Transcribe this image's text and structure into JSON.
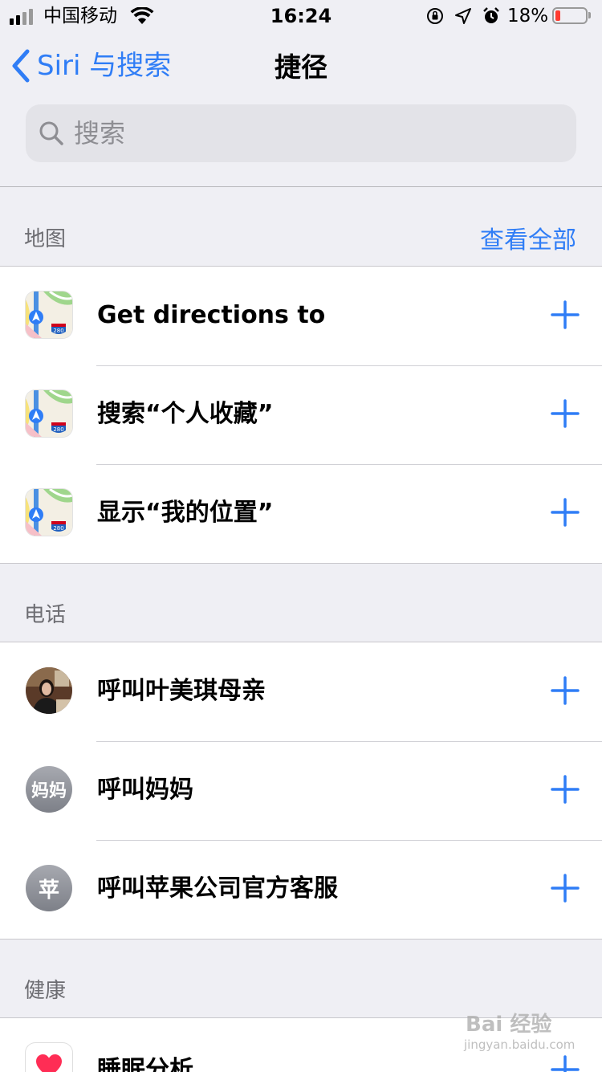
{
  "status_bar": {
    "carrier": "中国移动",
    "time": "16:24",
    "battery_percent": "18%",
    "battery_level": 0.18,
    "icons": [
      "orientation-lock-icon",
      "location-arrow-icon",
      "alarm-icon"
    ]
  },
  "nav": {
    "back_label": "Siri 与搜索",
    "title": "捷径"
  },
  "search": {
    "placeholder": "搜索"
  },
  "sections": {
    "maps": {
      "title": "地图",
      "action": "查看全部",
      "rows": [
        {
          "label": "Get directions to"
        },
        {
          "label": "搜索“个人收藏”"
        },
        {
          "label": "显示“我的位置”"
        }
      ]
    },
    "phone": {
      "title": "电话",
      "rows": [
        {
          "label": "呼叫叶美琪母亲"
        },
        {
          "label": "呼叫妈妈",
          "avatar_text": "妈妈"
        },
        {
          "label": "呼叫苹果公司官方客服",
          "avatar_text": "苹"
        }
      ]
    },
    "health": {
      "title": "健康",
      "rows": [
        {
          "label": "睡眠分析"
        }
      ]
    }
  },
  "maps_icon_badge": "280",
  "watermark": {
    "text": "Bai 经验",
    "sub": "jingyan.baidu.com"
  },
  "colors": {
    "accent": "#2f7df6",
    "background": "#efeff4",
    "battery_low": "#ff3b30"
  }
}
